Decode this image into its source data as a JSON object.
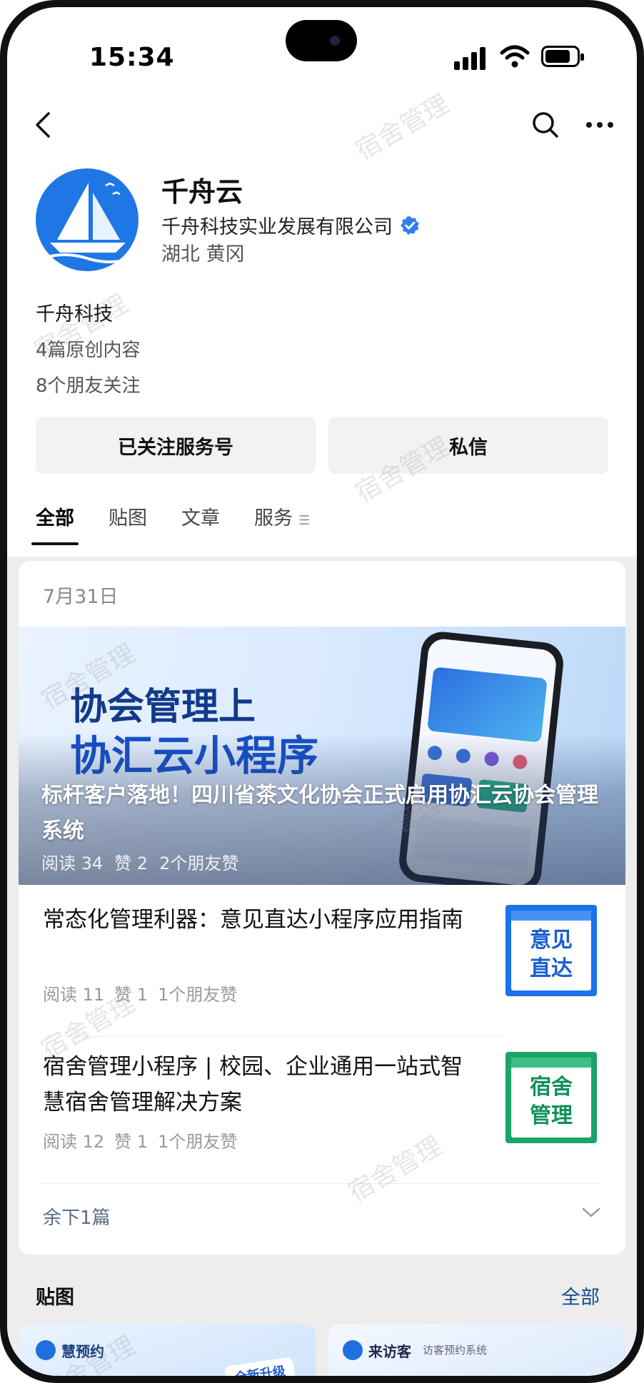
{
  "status": {
    "time": "15:34"
  },
  "account": {
    "name": "千舟云",
    "company": "千舟科技实业发展有限公司",
    "location": "湖北 黄冈",
    "intro": "千舟科技",
    "original_count": "4篇原创内容",
    "friends_following": "8个朋友关注"
  },
  "actions": {
    "followed": "已关注服务号",
    "message": "私信"
  },
  "tabs": [
    "全部",
    "贴图",
    "文章",
    "服务"
  ],
  "feed": {
    "date": "7月31日",
    "banner": {
      "line1": "协会管理上",
      "line2": "协汇云小程序",
      "title": "标杆客户落地！四川省茶文化协会正式启用协汇云协会管理系统",
      "reads": "阅读 34",
      "likes": "赞 2",
      "friend_likes": "2个朋友赞"
    },
    "articles": [
      {
        "title": "常态化管理利器：意见直达小程序应用指南",
        "reads": "阅读 11",
        "likes": "赞 1",
        "friend_likes": "1个朋友赞",
        "thumb_text_1": "意见",
        "thumb_text_2": "直达",
        "thumb_color": "#1a73e8"
      },
      {
        "title": "宿舍管理小程序 | 校园、企业通用一站式智慧宿舍管理解决方案",
        "reads": "阅读 12",
        "likes": "赞 1",
        "friend_likes": "1个朋友赞",
        "thumb_text_1": "宿舍",
        "thumb_text_2": "管理",
        "thumb_color": "#1aa56a"
      }
    ],
    "remaining": "余下1篇"
  },
  "posts_section": {
    "title": "贴图",
    "all_link": "全部",
    "card1_brand": "慧预约",
    "card1_badge": "全新升级",
    "card2_brand": "来访客",
    "card2_sub": "访客预约系统"
  },
  "watermark": "宿舍管理",
  "colors": {
    "accent": "#1f77e5",
    "link": "#1c4d8f",
    "verified": "#2f7ff0"
  }
}
